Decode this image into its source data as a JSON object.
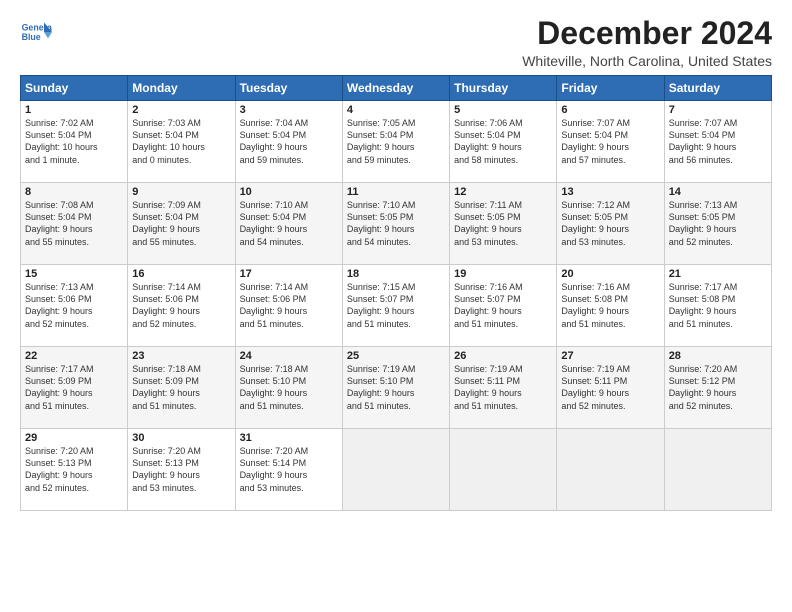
{
  "logo": {
    "line1": "General",
    "line2": "Blue"
  },
  "title": "December 2024",
  "location": "Whiteville, North Carolina, United States",
  "days_of_week": [
    "Sunday",
    "Monday",
    "Tuesday",
    "Wednesday",
    "Thursday",
    "Friday",
    "Saturday"
  ],
  "weeks": [
    [
      {
        "day": "1",
        "info": "Sunrise: 7:02 AM\nSunset: 5:04 PM\nDaylight: 10 hours\nand 1 minute."
      },
      {
        "day": "2",
        "info": "Sunrise: 7:03 AM\nSunset: 5:04 PM\nDaylight: 10 hours\nand 0 minutes."
      },
      {
        "day": "3",
        "info": "Sunrise: 7:04 AM\nSunset: 5:04 PM\nDaylight: 9 hours\nand 59 minutes."
      },
      {
        "day": "4",
        "info": "Sunrise: 7:05 AM\nSunset: 5:04 PM\nDaylight: 9 hours\nand 59 minutes."
      },
      {
        "day": "5",
        "info": "Sunrise: 7:06 AM\nSunset: 5:04 PM\nDaylight: 9 hours\nand 58 minutes."
      },
      {
        "day": "6",
        "info": "Sunrise: 7:07 AM\nSunset: 5:04 PM\nDaylight: 9 hours\nand 57 minutes."
      },
      {
        "day": "7",
        "info": "Sunrise: 7:07 AM\nSunset: 5:04 PM\nDaylight: 9 hours\nand 56 minutes."
      }
    ],
    [
      {
        "day": "8",
        "info": "Sunrise: 7:08 AM\nSunset: 5:04 PM\nDaylight: 9 hours\nand 55 minutes."
      },
      {
        "day": "9",
        "info": "Sunrise: 7:09 AM\nSunset: 5:04 PM\nDaylight: 9 hours\nand 55 minutes."
      },
      {
        "day": "10",
        "info": "Sunrise: 7:10 AM\nSunset: 5:04 PM\nDaylight: 9 hours\nand 54 minutes."
      },
      {
        "day": "11",
        "info": "Sunrise: 7:10 AM\nSunset: 5:05 PM\nDaylight: 9 hours\nand 54 minutes."
      },
      {
        "day": "12",
        "info": "Sunrise: 7:11 AM\nSunset: 5:05 PM\nDaylight: 9 hours\nand 53 minutes."
      },
      {
        "day": "13",
        "info": "Sunrise: 7:12 AM\nSunset: 5:05 PM\nDaylight: 9 hours\nand 53 minutes."
      },
      {
        "day": "14",
        "info": "Sunrise: 7:13 AM\nSunset: 5:05 PM\nDaylight: 9 hours\nand 52 minutes."
      }
    ],
    [
      {
        "day": "15",
        "info": "Sunrise: 7:13 AM\nSunset: 5:06 PM\nDaylight: 9 hours\nand 52 minutes."
      },
      {
        "day": "16",
        "info": "Sunrise: 7:14 AM\nSunset: 5:06 PM\nDaylight: 9 hours\nand 52 minutes."
      },
      {
        "day": "17",
        "info": "Sunrise: 7:14 AM\nSunset: 5:06 PM\nDaylight: 9 hours\nand 51 minutes."
      },
      {
        "day": "18",
        "info": "Sunrise: 7:15 AM\nSunset: 5:07 PM\nDaylight: 9 hours\nand 51 minutes."
      },
      {
        "day": "19",
        "info": "Sunrise: 7:16 AM\nSunset: 5:07 PM\nDaylight: 9 hours\nand 51 minutes."
      },
      {
        "day": "20",
        "info": "Sunrise: 7:16 AM\nSunset: 5:08 PM\nDaylight: 9 hours\nand 51 minutes."
      },
      {
        "day": "21",
        "info": "Sunrise: 7:17 AM\nSunset: 5:08 PM\nDaylight: 9 hours\nand 51 minutes."
      }
    ],
    [
      {
        "day": "22",
        "info": "Sunrise: 7:17 AM\nSunset: 5:09 PM\nDaylight: 9 hours\nand 51 minutes."
      },
      {
        "day": "23",
        "info": "Sunrise: 7:18 AM\nSunset: 5:09 PM\nDaylight: 9 hours\nand 51 minutes."
      },
      {
        "day": "24",
        "info": "Sunrise: 7:18 AM\nSunset: 5:10 PM\nDaylight: 9 hours\nand 51 minutes."
      },
      {
        "day": "25",
        "info": "Sunrise: 7:19 AM\nSunset: 5:10 PM\nDaylight: 9 hours\nand 51 minutes."
      },
      {
        "day": "26",
        "info": "Sunrise: 7:19 AM\nSunset: 5:11 PM\nDaylight: 9 hours\nand 51 minutes."
      },
      {
        "day": "27",
        "info": "Sunrise: 7:19 AM\nSunset: 5:11 PM\nDaylight: 9 hours\nand 52 minutes."
      },
      {
        "day": "28",
        "info": "Sunrise: 7:20 AM\nSunset: 5:12 PM\nDaylight: 9 hours\nand 52 minutes."
      }
    ],
    [
      {
        "day": "29",
        "info": "Sunrise: 7:20 AM\nSunset: 5:13 PM\nDaylight: 9 hours\nand 52 minutes."
      },
      {
        "day": "30",
        "info": "Sunrise: 7:20 AM\nSunset: 5:13 PM\nDaylight: 9 hours\nand 53 minutes."
      },
      {
        "day": "31",
        "info": "Sunrise: 7:20 AM\nSunset: 5:14 PM\nDaylight: 9 hours\nand 53 minutes."
      },
      {
        "day": "",
        "info": ""
      },
      {
        "day": "",
        "info": ""
      },
      {
        "day": "",
        "info": ""
      },
      {
        "day": "",
        "info": ""
      }
    ]
  ]
}
